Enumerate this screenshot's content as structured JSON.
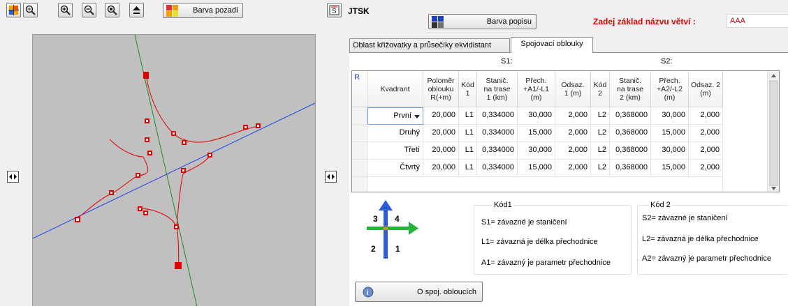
{
  "toolbar": {
    "barva_pozadi_label": "Barva pozadí",
    "system_label": "JTSK",
    "barva_popisu_label": "Barva popisu",
    "branch_prompt": "Zadej základ názvu větví :",
    "branch_value": "AAA",
    "colors": {
      "prompt": "#e00000",
      "branch_value": "#cc0000"
    }
  },
  "tabs": [
    {
      "label": "Oblast křižovatky a průsečíky ekvidistant",
      "active": false
    },
    {
      "label": "Spojovací oblouky",
      "active": true
    }
  ],
  "grid": {
    "group_headers": {
      "s1": "S1:",
      "s2": "S2:"
    },
    "corner_label": "R",
    "columns": [
      "Kvadrant",
      "Poloměr\noblouku\nR(+m)",
      "Kód\n1",
      "Stanič.\nna trase\n1 (km)",
      "Přech.\n+A1/-L1\n(m)",
      "Odsaz.\n1 (m)",
      "Kód\n2",
      "Stanič.\nna trase\n2 (km)",
      "Přech.\n+A2/-L2\n(m)",
      "Odsaz. 2\n(m)"
    ],
    "rows": [
      [
        "První",
        "20,000",
        "L1",
        "0,334000",
        "30,000",
        "2,000",
        "L2",
        "0,368000",
        "30,000",
        "2,000"
      ],
      [
        "Druhý",
        "20,000",
        "L1",
        "0,334000",
        "15,000",
        "2,000",
        "L2",
        "0,368000",
        "15,000",
        "2,000"
      ],
      [
        "Třetí",
        "20,000",
        "L1",
        "0,334000",
        "30,000",
        "2,000",
        "L2",
        "0,368000",
        "30,000",
        "2,000"
      ],
      [
        "Čtvrtý",
        "20,000",
        "L1",
        "0,334000",
        "15,000",
        "2,000",
        "L2",
        "0,368000",
        "15,000",
        "2,000"
      ]
    ]
  },
  "legend": {
    "quadrants": {
      "q1": "1",
      "q2": "2",
      "q3": "3",
      "q4": "4"
    },
    "kod1": {
      "title": "Kód1",
      "lines": [
        "S1= závazné je staničení",
        "L1= závazná je délka přechodnice",
        "A1= závazný je parametr přechodnice"
      ]
    },
    "kod2": {
      "title": "Kód 2",
      "lines": [
        "S2= závazné je staničení",
        "L2= závazná je délka přechodnice",
        "A2= závazný je parametr přechodnice"
      ]
    }
  },
  "about_button_label": "O spoj. obloucích",
  "icons": [
    "snap-icon",
    "zoom-window-icon",
    "zoom-in-icon",
    "zoom-out-icon",
    "zoom-all-icon",
    "pan-up-icon",
    "color-swatch-icon",
    "coordinate-system-icon",
    "pan-left-icon",
    "pan-right-icon",
    "info-icon"
  ],
  "drawing_colors": {
    "canvas": "#c0c0c0",
    "route_1": "#1a8a1a",
    "route_2": "#2040e0",
    "curves": "#e00000",
    "markers": "#e00000"
  }
}
